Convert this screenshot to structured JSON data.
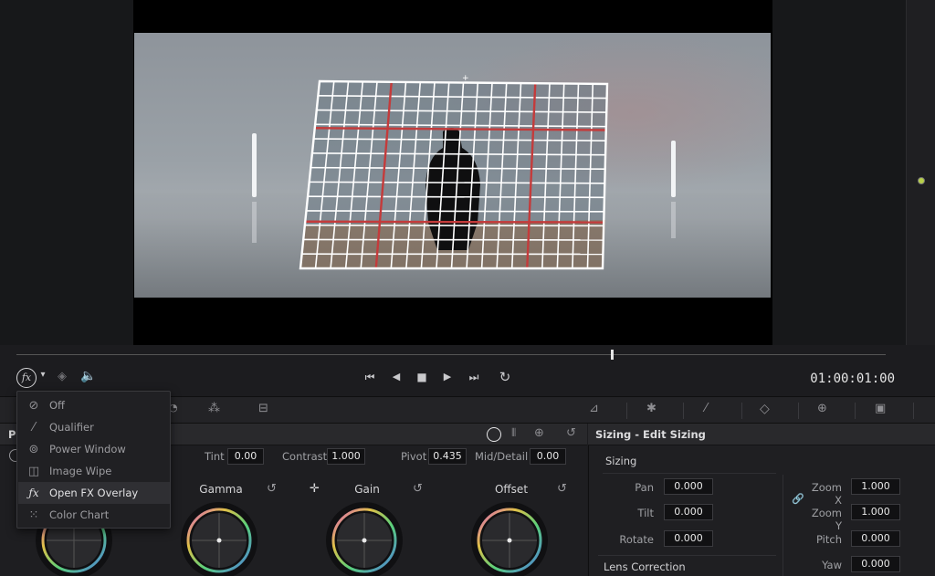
{
  "viewer": {
    "timecode": "01:00:01:00",
    "playhead_fraction": 0.685
  },
  "transport": {
    "fx_icon": "fx-icon",
    "dropdown_chevron": "chevron-down-icon",
    "layers_icon": "layers-icon",
    "audio_icon": "speaker-icon",
    "buttons": [
      "skip-to-start-icon",
      "reverse-play-icon",
      "stop-icon",
      "play-icon",
      "skip-to-end-icon",
      "loop-icon"
    ]
  },
  "overlay_menu": {
    "items": [
      {
        "label": "Off",
        "icon": "off-icon"
      },
      {
        "label": "Qualifier",
        "icon": "eyedropper-icon"
      },
      {
        "label": "Power Window",
        "icon": "power-window-icon"
      },
      {
        "label": "Image Wipe",
        "icon": "image-wipe-icon"
      },
      {
        "label": "Open FX Overlay",
        "icon": "fx-icon",
        "selected": true
      },
      {
        "label": "Color Chart",
        "icon": "color-chart-icon"
      }
    ]
  },
  "primaries": {
    "tab_initial": "P",
    "tint_label": "Tint",
    "tint_value": "0.00",
    "contrast_label": "Contrast",
    "contrast_value": "1.000",
    "pivot_label": "Pivot",
    "pivot_value": "0.435",
    "middetail_label": "Mid/Detail",
    "middetail_value": "0.00",
    "wheels": [
      {
        "label": "Gamma"
      },
      {
        "label": "Gain"
      },
      {
        "label": "Offset"
      }
    ]
  },
  "sizing": {
    "panel_title": "Sizing - Edit Sizing",
    "section_title": "Sizing",
    "fields": [
      {
        "label": "Pan",
        "value": "0.000"
      },
      {
        "label": "Tilt",
        "value": "0.000"
      },
      {
        "label": "Rotate",
        "value": "0.000"
      }
    ],
    "right_fields": [
      {
        "label": "Zoom X",
        "value": "1.000"
      },
      {
        "label": "Zoom Y",
        "value": "1.000"
      },
      {
        "label": "Pitch",
        "value": "0.000"
      },
      {
        "label": "Yaw",
        "value": "0.000"
      }
    ],
    "lens_title": "Lens Correction"
  }
}
